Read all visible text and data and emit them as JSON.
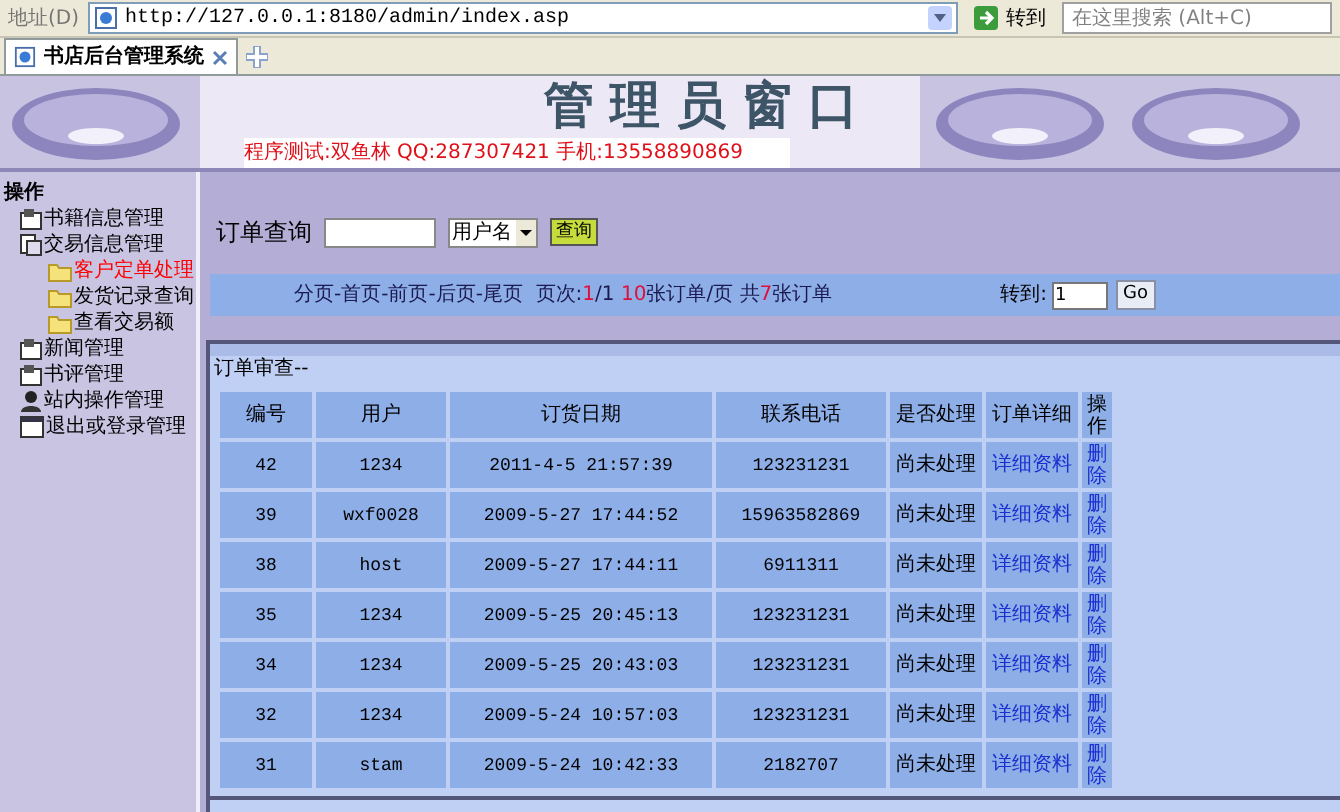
{
  "address_bar": {
    "label": "地址(D)",
    "url": "http://127.0.0.1:8180/admin/index.asp",
    "go": "转到",
    "search_placeholder": "在这里搜索 (Alt+C)"
  },
  "tabs": [
    {
      "label": "书店后台管理系统",
      "selected": true
    }
  ],
  "banner": {
    "title": "管理员窗口",
    "subtitle": "程序测试:双鱼林 QQ:287307421 手机:13558890869"
  },
  "sidebar": {
    "heading": "操作",
    "items": [
      {
        "label": "书籍信息管理",
        "kind": "book",
        "selected": false
      },
      {
        "label": "交易信息管理",
        "kind": "doc",
        "selected": false,
        "expanded": true,
        "children": [
          {
            "label": "客户定单处理",
            "kind": "folder",
            "selected": true
          },
          {
            "label": "发货记录查询",
            "kind": "folder",
            "selected": false
          },
          {
            "label": "查看交易额",
            "kind": "folder",
            "selected": false
          }
        ]
      },
      {
        "label": "新闻管理",
        "kind": "book",
        "selected": false
      },
      {
        "label": "书评管理",
        "kind": "book",
        "selected": false
      },
      {
        "label": "站内操作管理",
        "kind": "user",
        "selected": false
      },
      {
        "label": "退出或登录管理",
        "kind": "window",
        "selected": false
      }
    ]
  },
  "search": {
    "label": "订单查询",
    "field_option": "用户名",
    "button": "查询"
  },
  "pager": {
    "parts": [
      {
        "text": "分页-首页-前页-后页-尾页  页次:",
        "highlight": false
      },
      {
        "text": "1",
        "highlight": true
      },
      {
        "text": "/1 ",
        "highlight": false
      },
      {
        "text": "10",
        "highlight": true
      },
      {
        "text": "张订单/页 共",
        "highlight": false
      },
      {
        "text": "7",
        "highlight": true
      },
      {
        "text": "张订单",
        "highlight": false
      }
    ],
    "goto_label": "转到:",
    "goto_value": "1",
    "go": "Go"
  },
  "panel": {
    "title": "订单审查--"
  },
  "table": {
    "columns": [
      "编号",
      "用户",
      "订货日期",
      "联系电话",
      "是否处理",
      "订单详细",
      "操作"
    ],
    "rows": [
      {
        "id": "42",
        "user": "1234",
        "date": "2011-4-5 21:57:39",
        "phone": "123231231",
        "status": "尚未处理",
        "detail": "详细资料",
        "action": "删除"
      },
      {
        "id": "39",
        "user": "wxf0028",
        "date": "2009-5-27 17:44:52",
        "phone": "15963582869",
        "status": "尚未处理",
        "detail": "详细资料",
        "action": "删除"
      },
      {
        "id": "38",
        "user": "host",
        "date": "2009-5-27 17:44:11",
        "phone": "6911311",
        "status": "尚未处理",
        "detail": "详细资料",
        "action": "删除"
      },
      {
        "id": "35",
        "user": "1234",
        "date": "2009-5-25 20:45:13",
        "phone": "123231231",
        "status": "尚未处理",
        "detail": "详细资料",
        "action": "删除"
      },
      {
        "id": "34",
        "user": "1234",
        "date": "2009-5-25 20:43:03",
        "phone": "123231231",
        "status": "尚未处理",
        "detail": "详细资料",
        "action": "删除"
      },
      {
        "id": "32",
        "user": "1234",
        "date": "2009-5-24 10:57:03",
        "phone": "123231231",
        "status": "尚未处理",
        "detail": "详细资料",
        "action": "删除"
      },
      {
        "id": "31",
        "user": "stam",
        "date": "2009-5-24 10:42:33",
        "phone": "2182707",
        "status": "尚未处理",
        "detail": "详细资料",
        "action": "删除"
      }
    ]
  }
}
